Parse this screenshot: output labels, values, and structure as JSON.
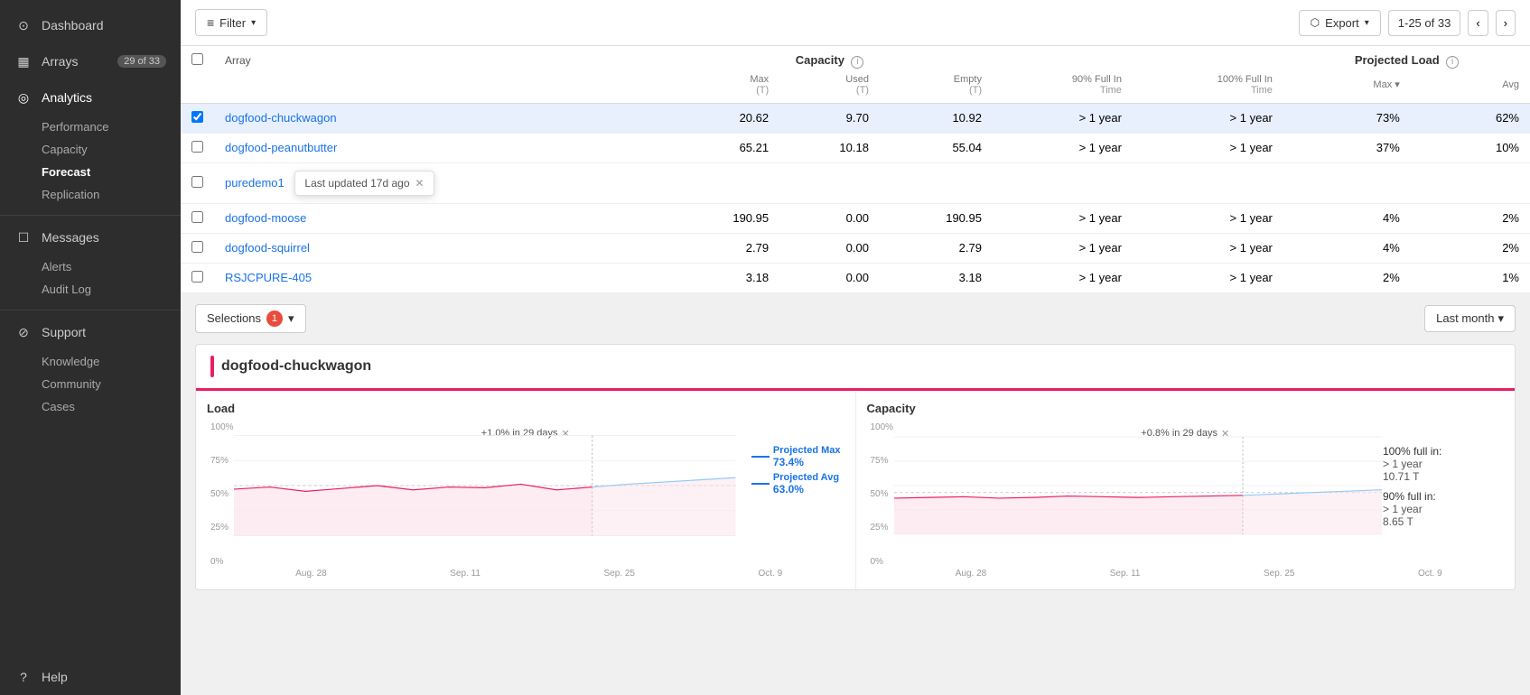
{
  "sidebar": {
    "items": [
      {
        "id": "dashboard",
        "label": "Dashboard",
        "icon": "⊙",
        "badge": null,
        "active": false
      },
      {
        "id": "arrays",
        "label": "Arrays",
        "icon": "▦",
        "badge": "29 of 33",
        "active": false
      },
      {
        "id": "analytics",
        "label": "Analytics",
        "icon": "◎",
        "active": true,
        "subitems": [
          {
            "id": "performance",
            "label": "Performance",
            "active": false
          },
          {
            "id": "capacity",
            "label": "Capacity",
            "active": false
          },
          {
            "id": "forecast",
            "label": "Forecast",
            "active": true
          },
          {
            "id": "replication",
            "label": "Replication",
            "active": false
          }
        ]
      },
      {
        "id": "messages",
        "label": "Messages",
        "icon": "☐",
        "active": false,
        "subitems": [
          {
            "id": "alerts",
            "label": "Alerts",
            "active": false
          },
          {
            "id": "audit-log",
            "label": "Audit Log",
            "active": false
          }
        ]
      },
      {
        "id": "support",
        "label": "Support",
        "icon": "⊘",
        "active": false,
        "subitems": [
          {
            "id": "knowledge",
            "label": "Knowledge",
            "active": false
          },
          {
            "id": "community",
            "label": "Community",
            "active": false
          },
          {
            "id": "cases",
            "label": "Cases",
            "active": false
          }
        ]
      }
    ],
    "help_label": "Help"
  },
  "toolbar": {
    "filter_label": "Filter",
    "export_label": "Export",
    "pagination": "1-25 of 33"
  },
  "table": {
    "columns": {
      "array": "Array",
      "capacity_group": "Capacity",
      "capacity_info": "i",
      "max": "Max",
      "max_unit": "(T)",
      "used": "Used",
      "used_unit": "(T)",
      "empty": "Empty",
      "empty_unit": "(T)",
      "full_90": "90% Full In",
      "full_90_sub": "Time",
      "full_100": "100% Full In",
      "full_100_sub": "Time",
      "proj_load_group": "Projected Load",
      "proj_load_info": "i",
      "proj_max": "Max ▾",
      "proj_avg": "Avg"
    },
    "rows": [
      {
        "id": "dogfood-chuckwagon",
        "name": "dogfood-chuckwagon",
        "max": "20.62",
        "used": "9.70",
        "empty": "10.92",
        "full_90": "> 1 year",
        "full_100": "> 1 year",
        "proj_max": "73%",
        "proj_avg": "62%",
        "selected": true
      },
      {
        "id": "dogfood-peanutbutter",
        "name": "dogfood-peanutbutter",
        "max": "65.21",
        "used": "10.18",
        "empty": "55.04",
        "full_90": "> 1 year",
        "full_100": "> 1 year",
        "proj_max": "37%",
        "proj_avg": "10%",
        "selected": false
      },
      {
        "id": "puredemo1",
        "name": "puredemo1",
        "max": "",
        "used": "",
        "empty": "",
        "full_90": "",
        "full_100": "",
        "proj_max": "",
        "proj_avg": "",
        "selected": false,
        "tooltip": "Last updated 17d ago"
      },
      {
        "id": "dogfood-moose",
        "name": "dogfood-moose",
        "max": "190.95",
        "used": "0.00",
        "empty": "190.95",
        "full_90": "> 1 year",
        "full_100": "> 1 year",
        "proj_max": "4%",
        "proj_avg": "2%",
        "selected": false
      },
      {
        "id": "dogfood-squirrel",
        "name": "dogfood-squirrel",
        "max": "2.79",
        "used": "0.00",
        "empty": "2.79",
        "full_90": "> 1 year",
        "full_100": "> 1 year",
        "proj_max": "4%",
        "proj_avg": "2%",
        "selected": false
      },
      {
        "id": "RSJCPURE-405",
        "name": "RSJCPURE-405",
        "max": "3.18",
        "used": "0.00",
        "empty": "3.18",
        "full_90": "> 1 year",
        "full_100": "> 1 year",
        "proj_max": "2%",
        "proj_avg": "1%",
        "selected": false
      }
    ]
  },
  "selections": {
    "label": "Selections",
    "count": "1",
    "time_period": "Last month",
    "dropdown_arrow": "▾"
  },
  "detail": {
    "array_name": "dogfood-chuckwagon",
    "load_chart": {
      "title": "Load",
      "annotation": "+1.0% in 29 days",
      "projected_max_label": "Projected Max",
      "projected_max_value": "73.4%",
      "projected_avg_label": "Projected Avg",
      "projected_avg_value": "63.0%",
      "x_labels": [
        "Aug. 28",
        "Sep. 11",
        "Sep. 25",
        "Oct. 9"
      ],
      "y_labels": [
        "100%",
        "75%",
        "50%",
        "25%",
        "0%"
      ]
    },
    "capacity_chart": {
      "title": "Capacity",
      "annotation": "+0.8% in 29 days",
      "full_100_label": "100% full in:",
      "full_100_time": "> 1 year",
      "full_100_value": "10.71 T",
      "full_90_label": "90% full in:",
      "full_90_time": "> 1 year",
      "full_90_value": "8.65 T",
      "x_labels": [
        "Aug. 28",
        "Sep. 11",
        "Sep. 25",
        "Oct. 9"
      ],
      "y_labels": [
        "100%",
        "75%",
        "50%",
        "25%",
        "0%"
      ]
    }
  },
  "colors": {
    "accent": "#e91e63",
    "link": "#1a73e8",
    "sidebar_bg": "#2d2d2d",
    "projected_max": "#1a73e8",
    "projected_avg": "#1a73e8",
    "chart_fill": "#fce4ec",
    "chart_line": "#e91e63",
    "projected_line": "#90caf9",
    "dashed_line": "#aaa"
  }
}
